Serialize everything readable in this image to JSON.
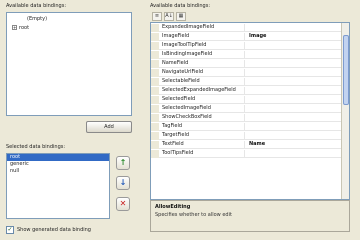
{
  "labels": {
    "available_data_bindings": "Available data bindings:",
    "selected_data_bindings": "Selected data bindings:",
    "available_attributes": "Available data bindings:",
    "show_data_binding": "Show generated data binding"
  },
  "tree": {
    "root": "(Empty)",
    "child": "root"
  },
  "buttons": {
    "add": "Add",
    "move_up": "↑",
    "move_down": "↓",
    "remove": "✕"
  },
  "selected_bindings": [
    "root",
    "generic",
    "null"
  ],
  "toolbar": {
    "items": [
      "≡",
      "A↓",
      "▦"
    ]
  },
  "properties": [
    {
      "name": "ExpandedImageField",
      "value": ""
    },
    {
      "name": "ImageField",
      "value": "Image"
    },
    {
      "name": "ImageToolTipField",
      "value": ""
    },
    {
      "name": "IsBindingImageField",
      "value": ""
    },
    {
      "name": "NameField",
      "value": ""
    },
    {
      "name": "NavigateUrlField",
      "value": ""
    },
    {
      "name": "SelectableField",
      "value": ""
    },
    {
      "name": "SelectedExpandedImageField",
      "value": ""
    },
    {
      "name": "SelectedField",
      "value": ""
    },
    {
      "name": "SelectedImageField",
      "value": ""
    },
    {
      "name": "ShowCheckBoxField",
      "value": ""
    },
    {
      "name": "TagField",
      "value": ""
    },
    {
      "name": "TargetField",
      "value": ""
    },
    {
      "name": "TextField",
      "value": "Name"
    },
    {
      "name": "ToolTipsField",
      "value": ""
    }
  ],
  "description": {
    "title": "AllowEditing",
    "text": "Specifies whether to allow edit"
  },
  "checkbox_checked": true
}
